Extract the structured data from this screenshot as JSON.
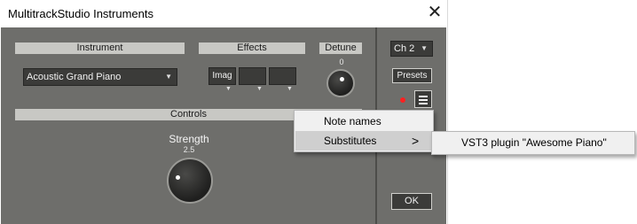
{
  "window": {
    "title": "MultitrackStudio Instruments"
  },
  "instrument": {
    "header": "Instrument",
    "selected": "Acoustic Grand Piano"
  },
  "effects": {
    "header": "Effects",
    "slots": [
      "Imag",
      "",
      ""
    ]
  },
  "detune": {
    "header": "Detune",
    "value": "0"
  },
  "controls": {
    "header": "Controls",
    "strength_label": "Strength",
    "strength_value": "2.5"
  },
  "side": {
    "channel": "Ch 2",
    "presets_label": "Presets",
    "ok_label": "OK"
  },
  "context_menu": {
    "items": [
      {
        "label": "Note names"
      },
      {
        "label": "Substitutes"
      }
    ]
  },
  "submenu": {
    "items": [
      {
        "label": "VST3 plugin \"Awesome Piano\""
      }
    ]
  },
  "colors": {
    "panel": "#6e6e6b",
    "header_bar": "#c8c8c4",
    "record_dot": "#ff2020",
    "menu_bg": "#f0f0f0",
    "menu_highlight": "#cfcfcf"
  },
  "icons": [
    "close-icon",
    "dropdown-arrow-icon",
    "menu-icon",
    "chevron-right-icon",
    "record-indicator-icon"
  ]
}
